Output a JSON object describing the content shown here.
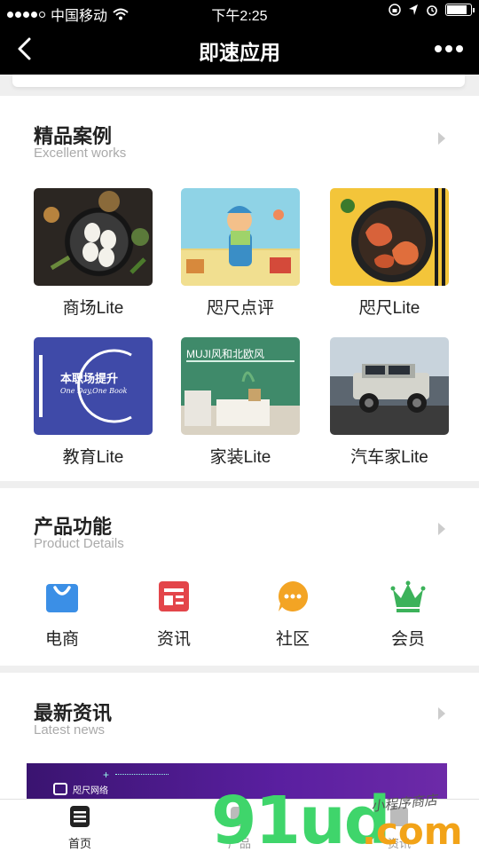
{
  "status_bar": {
    "carrier": "中国移动",
    "time": "下午2:25",
    "battery_level": 0.8
  },
  "nav": {
    "title": "即速应用"
  },
  "sections": {
    "works": {
      "title": "精品案例",
      "subtitle": "Excellent works",
      "items": [
        {
          "label": "商场Lite"
        },
        {
          "label": "咫尺点评"
        },
        {
          "label": "咫尺Lite"
        },
        {
          "label": "教育Lite",
          "image_text": "本职场提升",
          "image_subtext": "One Day,One Book"
        },
        {
          "label": "家装Lite",
          "image_text": "MUJI风和北欧风"
        },
        {
          "label": "汽车家Lite"
        }
      ]
    },
    "features": {
      "title": "产品功能",
      "subtitle": "Product Details",
      "items": [
        {
          "label": "电商",
          "icon": "shopping-bag-icon",
          "color": "#3b8fe6"
        },
        {
          "label": "资讯",
          "icon": "news-icon",
          "color": "#e3454a"
        },
        {
          "label": "社区",
          "icon": "chat-bubble-icon",
          "color": "#f3a424"
        },
        {
          "label": "会员",
          "icon": "crown-icon",
          "color": "#3cb25a"
        }
      ]
    },
    "news": {
      "title": "最新资讯",
      "subtitle": "Latest news",
      "banner_brand": "咫尺网络"
    }
  },
  "tabs": [
    {
      "label": "首页",
      "active": true
    },
    {
      "label": "产品",
      "active": false
    },
    {
      "label": "资讯",
      "active": false
    }
  ],
  "watermark": {
    "main": "91ud",
    "suffix": ".com",
    "caption": "小程序商店"
  }
}
